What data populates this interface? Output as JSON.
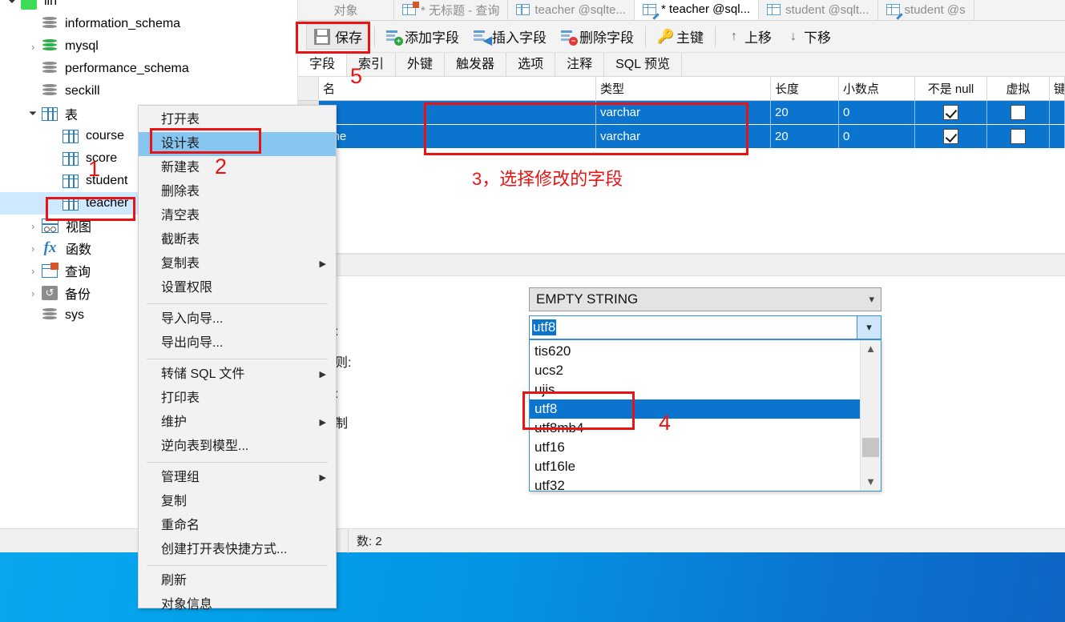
{
  "tree": {
    "items": [
      {
        "label": "lin",
        "icon": "connection-icon",
        "indent": 0,
        "chevron": "open",
        "cut": true
      },
      {
        "label": "information_schema",
        "icon": "database-icon",
        "indent": 1,
        "chevron": "none"
      },
      {
        "label": "mysql",
        "icon": "database-green-icon",
        "indent": 1,
        "chevron": "closed"
      },
      {
        "label": "performance_schema",
        "icon": "database-icon",
        "indent": 1,
        "chevron": "none"
      },
      {
        "label": "seckill",
        "icon": "database-icon",
        "indent": 1,
        "chevron": "none"
      },
      {
        "label": "表",
        "icon": "table-folder-icon",
        "indent": 1,
        "chevron": "open"
      },
      {
        "label": "course",
        "icon": "table-icon",
        "indent": 2,
        "chevron": "none"
      },
      {
        "label": "score",
        "icon": "table-icon",
        "indent": 2,
        "chevron": "none"
      },
      {
        "label": "student",
        "icon": "table-icon",
        "indent": 2,
        "chevron": "none"
      },
      {
        "label": "teacher",
        "icon": "table-icon",
        "indent": 2,
        "chevron": "none",
        "selected": true
      },
      {
        "label": "视图",
        "icon": "view-icon",
        "indent": 1,
        "chevron": "closed"
      },
      {
        "label": "函数",
        "icon": "function-icon",
        "indent": 1,
        "chevron": "closed"
      },
      {
        "label": "查询",
        "icon": "query-icon",
        "indent": 1,
        "chevron": "closed"
      },
      {
        "label": "备份",
        "icon": "backup-icon",
        "indent": 1,
        "chevron": "closed"
      },
      {
        "label": "sys",
        "icon": "database-icon",
        "indent": 1,
        "chevron": "none"
      }
    ]
  },
  "context_menu": {
    "items": [
      {
        "label": "打开表"
      },
      {
        "label": "设计表",
        "selected": true
      },
      {
        "label": "新建表"
      },
      {
        "label": "删除表"
      },
      {
        "label": "清空表"
      },
      {
        "label": "截断表"
      },
      {
        "label": "复制表",
        "submenu": true
      },
      {
        "label": "设置权限"
      },
      {
        "separator": true
      },
      {
        "label": "导入向导..."
      },
      {
        "label": "导出向导..."
      },
      {
        "separator": true
      },
      {
        "label": "转储 SQL 文件",
        "submenu": true
      },
      {
        "label": "打印表"
      },
      {
        "label": "维护",
        "submenu": true
      },
      {
        "label": "逆向表到模型..."
      },
      {
        "separator": true
      },
      {
        "label": "管理组",
        "submenu": true
      },
      {
        "label": "复制"
      },
      {
        "label": "重命名"
      },
      {
        "label": "创建打开表快捷方式..."
      },
      {
        "separator": true
      },
      {
        "label": "刷新"
      },
      {
        "label": "对象信息"
      }
    ]
  },
  "tabs": [
    {
      "label": "对象",
      "icon": "none",
      "active": false
    },
    {
      "label": "* 无标题 - 查询",
      "icon": "query-tab-icon",
      "active": false
    },
    {
      "label": "teacher @sqlte...",
      "icon": "table-tab-icon",
      "active": false
    },
    {
      "label": "* teacher @sql...",
      "icon": "table-design-tab-icon",
      "active": true
    },
    {
      "label": "student @sqlt...",
      "icon": "table-tab-icon",
      "active": false
    },
    {
      "label": "student @s",
      "icon": "table-design-tab-icon",
      "active": false
    }
  ],
  "toolbar": {
    "save_label": "保存",
    "add_field_label": "添加字段",
    "insert_field_label": "插入字段",
    "delete_field_label": "删除字段",
    "primary_key_label": "主键",
    "move_up_label": "上移",
    "move_down_label": "下移"
  },
  "subtabs": [
    {
      "label": "字段",
      "active": true
    },
    {
      "label": "索引",
      "active": false
    },
    {
      "label": "外键",
      "active": false
    },
    {
      "label": "触发器",
      "active": false
    },
    {
      "label": "选项",
      "active": false
    },
    {
      "label": "注释",
      "active": false
    },
    {
      "label": "SQL 预览",
      "active": false
    }
  ],
  "grid": {
    "columns": [
      "名",
      "类型",
      "长度",
      "小数点",
      "不是 null",
      "虚拟",
      "键"
    ],
    "rows": [
      {
        "name": "",
        "type": "varchar",
        "length": "20",
        "decimals": "0",
        "not_null": true,
        "virtual": false
      },
      {
        "name": "ame",
        "type": "varchar",
        "length": "20",
        "decimals": "0",
        "not_null": true,
        "virtual": false
      }
    ]
  },
  "properties": {
    "label_charset": "集:",
    "label_collation": "规则:",
    "label_length": "度:",
    "label_binary": "进制"
  },
  "combo": {
    "default_value": "EMPTY STRING",
    "edit_value": "utf8",
    "options": [
      "tis620",
      "ucs2",
      "ujis",
      "utf8",
      "utf8mb4",
      "utf16",
      "utf16le",
      "utf32"
    ],
    "selected_option": "utf8"
  },
  "statusbar": {
    "record_count": "数: 2"
  },
  "annotations": [
    {
      "id": "1",
      "text": "1"
    },
    {
      "id": "2",
      "text": "2"
    },
    {
      "id": "3",
      "text": "3，选择修改的字段"
    },
    {
      "id": "4",
      "text": "4"
    },
    {
      "id": "5",
      "text": "5"
    }
  ],
  "colors": {
    "accent_blue": "#0b74cf",
    "annotation_red": "#e81414",
    "menu_highlight": "#86c5f0",
    "tree_selection": "#cde8ff"
  }
}
